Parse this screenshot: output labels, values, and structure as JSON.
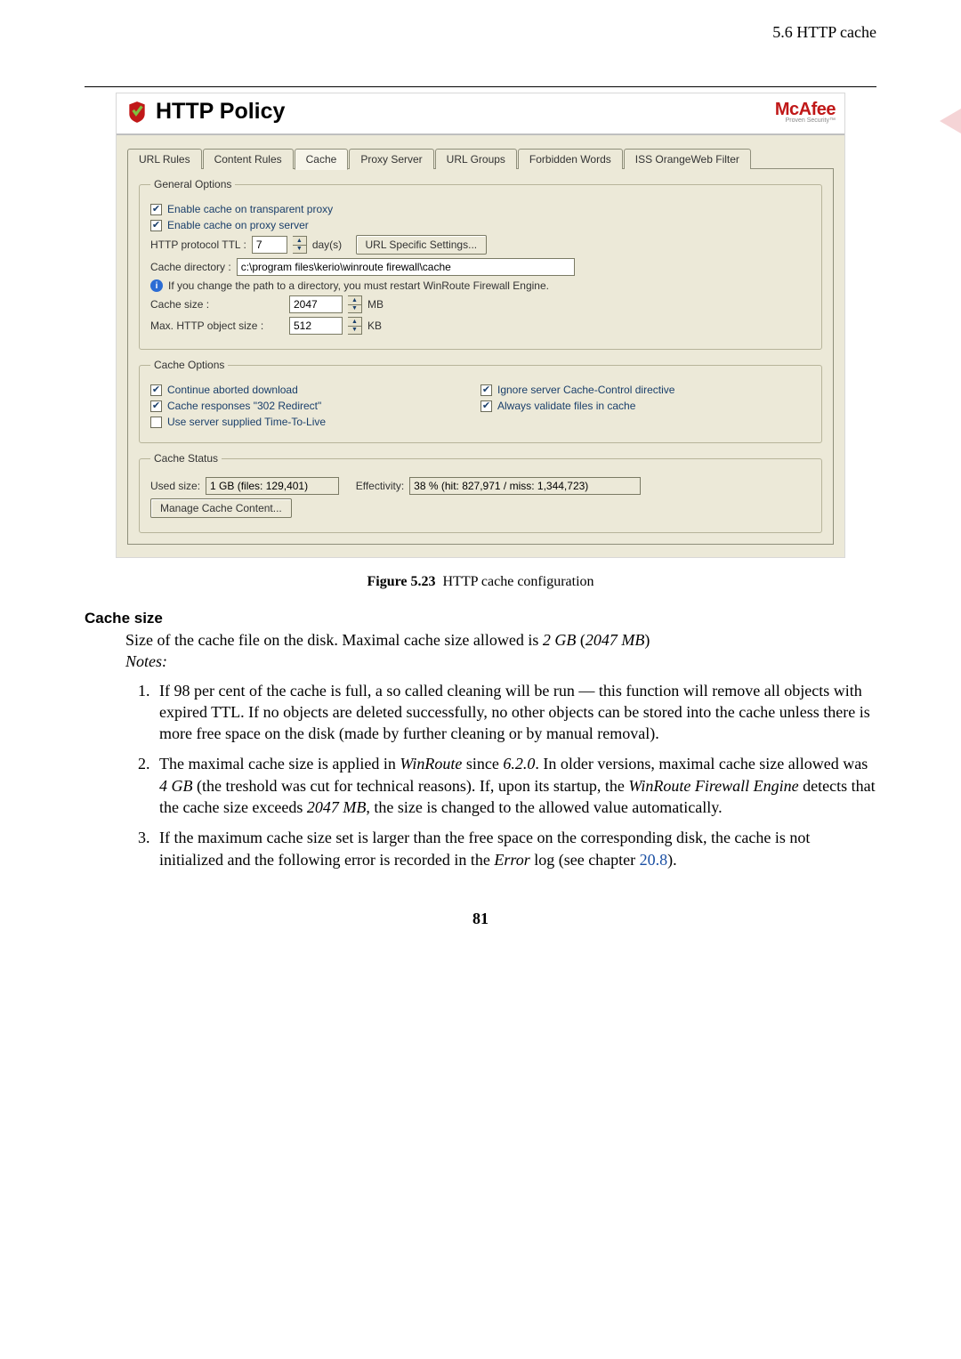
{
  "header": {
    "section": "5.6  HTTP cache"
  },
  "dialog": {
    "title": "HTTP Policy",
    "brand": "McAfee",
    "brand_sub": "Proven Security™",
    "tabs": {
      "url_rules": "URL Rules",
      "content_rules": "Content Rules",
      "cache": "Cache",
      "proxy_server": "Proxy Server",
      "url_groups": "URL Groups",
      "forbidden_words": "Forbidden Words",
      "iss": "ISS OrangeWeb Filter"
    },
    "general": {
      "legend": "General Options",
      "enable_transparent": "Enable cache on transparent proxy",
      "enable_proxy": "Enable cache on proxy server",
      "ttl_label": "HTTP protocol TTL :",
      "ttl_value": "7",
      "ttl_unit": "day(s)",
      "url_specific_btn": "URL Specific Settings...",
      "cache_dir_label": "Cache directory :",
      "cache_dir_value": "c:\\program files\\kerio\\winroute firewall\\cache",
      "info_text": "If you change the path to a directory, you must restart WinRoute Firewall Engine.",
      "cache_size_label": "Cache size :",
      "cache_size_value": "2047",
      "cache_size_unit": "MB",
      "max_obj_label": "Max. HTTP object size :",
      "max_obj_value": "512",
      "max_obj_unit": "KB"
    },
    "options": {
      "legend": "Cache Options",
      "continue_aborted": "Continue aborted download",
      "cache_302": "Cache responses \"302 Redirect\"",
      "use_server_ttl": "Use server supplied Time-To-Live",
      "ignore_cc": "Ignore server Cache-Control directive",
      "validate": "Always validate files in cache"
    },
    "status": {
      "legend": "Cache Status",
      "used_label": "Used size:",
      "used_value": "1 GB (files: 129,401)",
      "effect_label": "Effectivity:",
      "effect_value": "38 % (hit: 827,971 / miss: 1,344,723)",
      "manage_btn": "Manage Cache Content..."
    }
  },
  "figure": {
    "num": "Figure 5.23",
    "caption": "HTTP cache configuration"
  },
  "section": {
    "heading": "Cache size",
    "intro1": "Size of the cache file on the disk. Maximal cache size allowed is ",
    "intro_em1": "2 GB",
    "intro_paren": " (",
    "intro_em2": "2047 MB",
    "intro_end": ")",
    "notes_label": "Notes:",
    "items": [
      "If 98 per cent of the cache is full, a so called cleaning will be run — this function will remove all objects with expired TTL. If no objects are deleted successfully, no other objects can be stored into the cache unless there is more free space on the disk (made by further cleaning or by manual removal).",
      "The maximal cache size is applied in WinRoute since 6.2.0. In older versions, maximal cache size allowed was 4 GB (the treshold was cut for technical reasons). If, upon its startup, the WinRoute Firewall Engine detects that the cache size exceeds 2047 MB, the size is changed to the allowed value automatically.",
      "If the maximum cache size set is larger than the free space on the corresponding disk, the cache is not initialized and the following error is recorded in the Error log (see chapter 20.8)."
    ]
  },
  "page_number": "81"
}
